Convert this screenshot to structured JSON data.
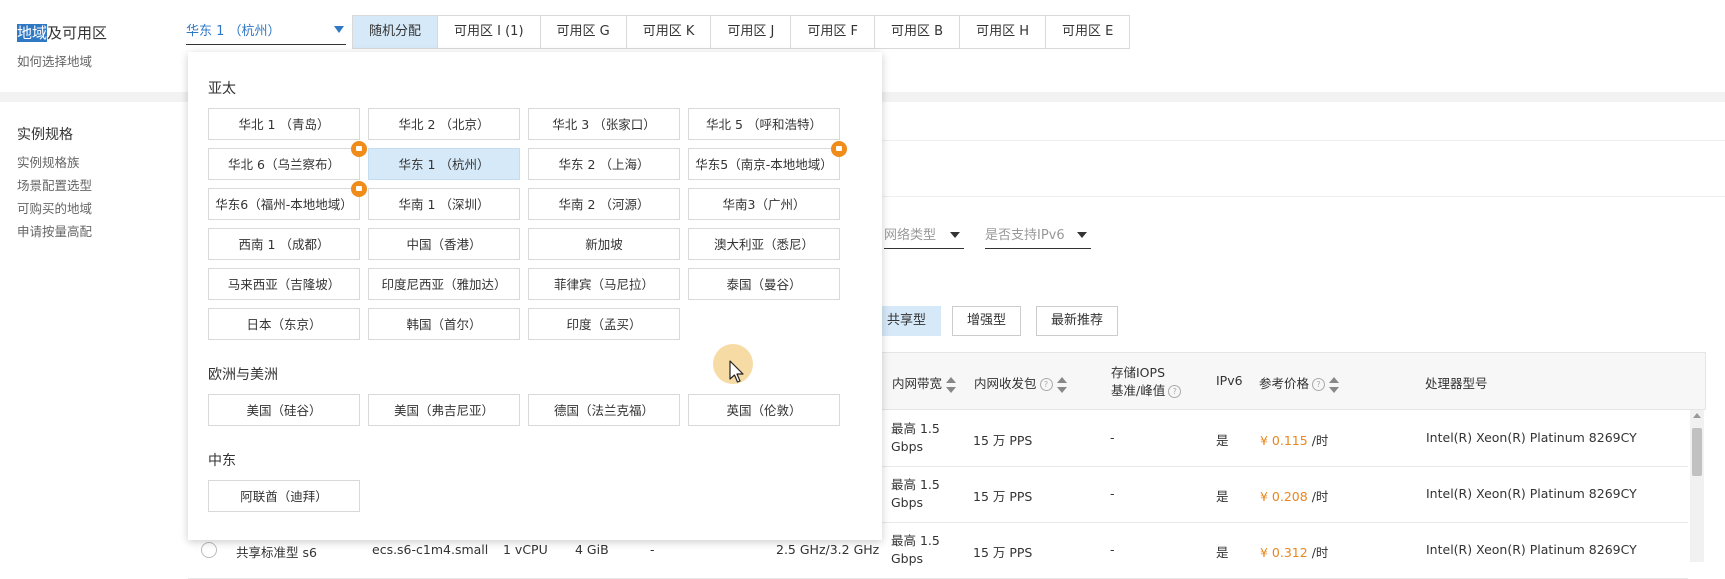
{
  "header": {
    "region_label_hl": "地域",
    "region_label_rest": "及可用区",
    "how_to_choose": "如何选择地域",
    "selected_region": "华东 1 （杭州）",
    "zone_tabs": [
      "随机分配",
      "可用区 I (1)",
      "可用区 G",
      "可用区 K",
      "可用区 J",
      "可用区 F",
      "可用区 B",
      "可用区 H",
      "可用区 E"
    ]
  },
  "sidebar": {
    "title": "实例规格",
    "links": [
      "实例规格族",
      "场景配置选型",
      "可购买的地域",
      "申请按量高配"
    ]
  },
  "filters": {
    "network_type": "网络类型",
    "ipv6": "是否支持IPv6"
  },
  "type_buttons": [
    "共享型",
    "增强型",
    "最新推荐"
  ],
  "table": {
    "headers": {
      "bandwidth": "内网带宽",
      "pps": "内网收发包",
      "iops_line1": "存储IOPS",
      "iops_line2": "基准/峰值",
      "ipv6": "IPv6",
      "price": "参考价格",
      "cpu": "处理器型号"
    },
    "rows": [
      {
        "bw1": "最高 1.5",
        "bw2": "Gbps",
        "pps": "15 万 PPS",
        "iops": "-",
        "ipv6": "是",
        "price": "¥ 0.115",
        "unit": " /时",
        "cpu": "Intel(R) Xeon(R) Platinum 8269CY"
      },
      {
        "bw1": "最高 1.5",
        "bw2": "Gbps",
        "pps": "15 万 PPS",
        "iops": "-",
        "ipv6": "是",
        "price": "¥ 0.208",
        "unit": " /时",
        "cpu": "Intel(R) Xeon(R) Platinum 8269CY"
      },
      {
        "name": "共享标准型 s6",
        "spec": "ecs.s6-c1m4.small",
        "vcpu": "1 vCPU",
        "mem": "4 GiB",
        "dash": "-",
        "freq": "2.5 GHz/3.2 GHz",
        "bw1": "最高 1.5",
        "bw2": "Gbps",
        "pps": "15 万 PPS",
        "iops": "-",
        "ipv6": "是",
        "price": "¥ 0.312",
        "unit": " /时",
        "cpu": "Intel(R) Xeon(R) Platinum 8269CY"
      }
    ]
  },
  "panel": {
    "groups": [
      {
        "title": "亚太",
        "items": [
          "华北 1 （青岛）",
          "华北 2 （北京）",
          "华北 3 （张家口）",
          "华北 5 （呼和浩特）",
          "华北 6（乌兰察布）",
          "华东 1 （杭州）",
          "华东 2 （上海）",
          "华东5（南京-本地地域）",
          "华东6（福州-本地地域）",
          "华南 1 （深圳）",
          "华南 2 （河源）",
          "华南3（广州）",
          "西南 1 （成都）",
          "中国（香港）",
          "新加坡",
          "澳大利亚（悉尼）",
          "马来西亚（吉隆坡）",
          "印度尼西亚（雅加达）",
          "菲律宾（马尼拉）",
          "泰国（曼谷）",
          "日本（东京）",
          "韩国（首尔）",
          "印度（孟买）"
        ]
      },
      {
        "title": "欧洲与美洲",
        "items": [
          "美国（硅谷）",
          "美国（弗吉尼亚）",
          "德国（法兰克福）",
          "英国（伦敦）"
        ]
      },
      {
        "title": "中东",
        "items": [
          "阿联酋（迪拜）"
        ]
      }
    ]
  },
  "colors": {
    "accent": "#2f78c4",
    "selected_bg": "#d6e9f8",
    "badge": "#f08c1a",
    "price": "#e8871e"
  }
}
